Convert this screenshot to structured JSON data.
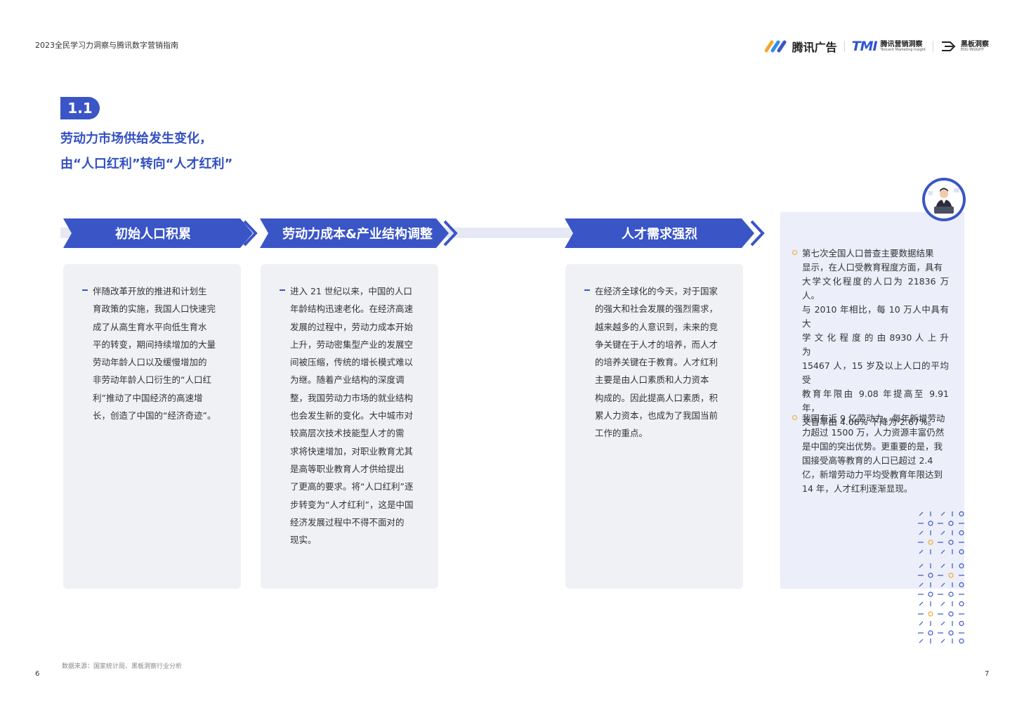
{
  "header": {
    "doc_title": "2023全民学习力洞察与腾讯数字营销指南",
    "logos": {
      "tencent_ads": "腾讯广告",
      "tmi_mark": "TMI",
      "tmi_name": "腾讯营销洞察",
      "tmi_en": "Tencent Marketing Insight",
      "edu_name": "黑板洞察",
      "edu_en": "EDU INSIGHT"
    }
  },
  "section": {
    "number": "1.1",
    "title_line1": "劳动力市场供给发生变化，",
    "title_line2": "由“人口红利”转向“人才红利”"
  },
  "stages": [
    {
      "label": "初始人口积累",
      "lines": [
        "伴随改革开放的推进和计划生",
        "育政策的实施，我国人口快速完",
        "成了从高生育水平向低生育水",
        "平的转变，期间持续增加的大量",
        "劳动年龄人口以及缓慢增加的",
        "非劳动年龄人口衍生的“人口红",
        "利”推动了中国经济的高速增",
        "长，创造了中国的“经济奇迹”。"
      ]
    },
    {
      "label": "劳动力成本&产业结构调整",
      "lines": [
        "进入 21 世纪以来，中国的人口",
        "年龄结构迅速老化。在经济高速",
        "发展的过程中，劳动力成本开始",
        "上升，劳动密集型产业的发展空",
        "间被压缩，传统的增长模式难以",
        "为继。随着产业结构的深度调",
        "整，我国劳动力市场的就业结构",
        "也会发生新的变化。大中城市对",
        "较高层次技术技能型人才的需",
        "求将快速增加，对职业教育尤其",
        "是高等职业教育人才供给提出",
        "了更高的要求。将“人口红利”逐",
        "步转变为“人才红利”，这是中国",
        "经济发展过程中不得不面对的",
        "现实。"
      ]
    },
    {
      "label": "人才需求强烈",
      "lines": [
        "在经济全球化的今天，对于国家",
        "的强大和社会发展的强烈需求，",
        "越来越多的人意识到，未来的竞",
        "争关键在于人才的培养，而人才",
        "的培养关键在于教育。人才红利",
        "主要是由人口素质和人力资本",
        "构成的。因此提高人口素质，积",
        "累人力资本，也成为了我国当前",
        "工作的重点。"
      ]
    }
  ],
  "facts": [
    {
      "lines": [
        "第七次全国人口普查主要数据结果",
        "显示，在人口受教育程度方面，具有",
        "大学文化程度的人口为 21836 万人。",
        "与 2010 年相比，每 10 万人中具有大",
        "学 文 化 程 度 的 由 8930 人 上 升 为",
        "15467 人，15 岁及以上人口的平均受",
        "教育年限由 9.08 年提高至 9.91 年，",
        "文盲率由 4.08% 下降为 2.67%。"
      ]
    },
    {
      "lines": [
        "我国有近 9 亿劳动力，每年新增劳动",
        "力超过 1500 万，人力资源丰富仍然",
        "是中国的突出优势。更重要的是，我",
        "国接受高等教育的人口已超过 2.4",
        "亿，新增劳动力平均受教育年限达到",
        "14 年，人才红利逐渐显现。"
      ]
    }
  ],
  "footer": {
    "source": "数据来源：国家统计局、黑板洞察行业分析",
    "page_left": "6",
    "page_right": "7"
  },
  "colors": {
    "primary": "#3a55c6",
    "accent": "#f0a830",
    "card_bg": "#f0f1f5",
    "panel_bg": "#eceef9"
  }
}
